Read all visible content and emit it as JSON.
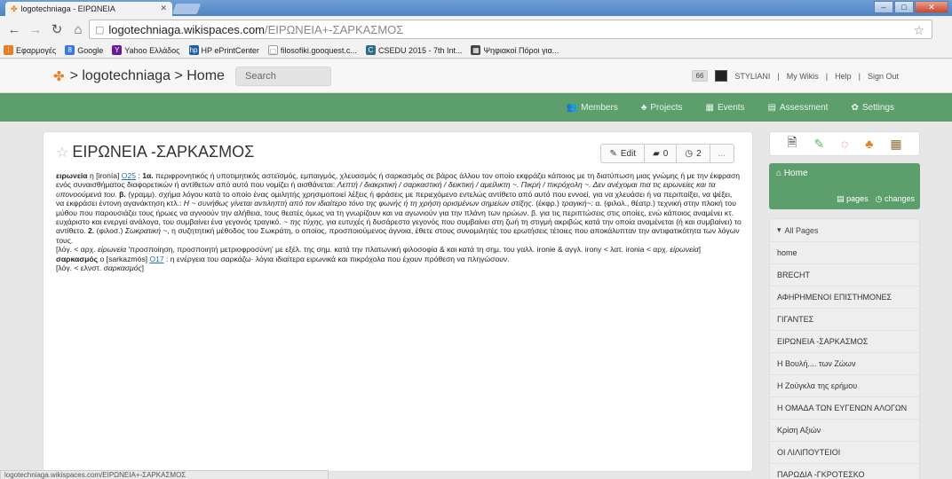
{
  "browser": {
    "tab_title": "logotechniaga - ΕΙΡΩΝΕΙΑ",
    "url_host": "logotechniaga.wikispaces.com",
    "url_path": "/ΕΙΡΩΝΕΙΑ+-ΣΑΡΚΑΣΜΟΣ",
    "bookmarks": [
      "Εφαρμογές",
      "Google",
      "Yahoo Ελλάδος",
      "HP ePrintCenter",
      "filosofiki.gooquest.c...",
      "CSEDU 2015 - 7th Int...",
      "Ψηφιακοί Πόροι για..."
    ],
    "status_text": "logotechniaga.wikispaces.com/ΕΙΡΩΝΕΙΑ+-ΣΑΡΚΑΣΜΟΣ"
  },
  "header": {
    "site": "> logotechniaga > Home",
    "search_placeholder": "Search",
    "badge": "66",
    "user": "STYLIANI",
    "links": [
      "My Wikis",
      "Help",
      "Sign Out"
    ]
  },
  "nav": [
    "Members",
    "Projects",
    "Events",
    "Assessment",
    "Settings"
  ],
  "page": {
    "title": "ΕΙΡΩΝΕΙΑ -ΣΑΡΚΑΣΜΟΣ",
    "edit_label": "Edit",
    "comments_count": "0",
    "revisions_count": "2",
    "more_label": "...",
    "p1_term": "ειρωνεία",
    "p1_ipa": " η [ironía] ",
    "p1_ref": "Ο25",
    "p1_text_a": " : ",
    "p1_sense": "1α.",
    "p1_text_b": " περιφρονητικός ή υποτιμητικός αστεϊσμός, εμπαιγμός, χλευασμός ή σαρκασμός σε βάρος άλλου τον οποίο εκφράζει κάποιος με τη διατύπωση μιας γνώμης ή με την έκφραση ενός συναισθήματος διαφορετικών ή αντίθετων από αυτό που νομίζει ή αισθάνεται: ",
    "p1_ex1": "Λεπτή / διακριτική / σαρκαστική / δεικτική / αμείλικτη ~. Πικρή / πικρόχολη ~. Δεν ανέχομαι πια τις ειρωνείες και τα υπονοούμενά του.",
    "p1_sense_b": " β.",
    "p1_text_c": " (γραμμ). σχήμα λόγου κατά το οποίο ένας ομιλητής χρησιμοποιεί λέξεις ή φράσεις με περιεχόμενο εντελώς αντίθετο από αυτό που εννοεί, για να χλευάσει ή να περιπαίξει, να ψέξει, να εκφράσει έντονη αγανάκτηση κτλ.: ",
    "p1_ex2": "Η ~ συνήθως γίνεται αντιληπτή από τον ιδιαίτερο τόνο της φωνής ή τη χρήση ορισμένων σημείων στίξης.",
    "p1_text_d": " (έκφρ.) ",
    "p1_ex3": "τραγική~:",
    "p1_text_e": " α. (φιλολ., θέατρ.) τεχνική στην πλοκή του μύθου που παρουσιάζει τους ήρωες να αγνοούν την αλήθεια, τους θεατές όμως να τη γνωρίζουν και να αγωνιούν για την πλάνη των ηρώων. β. για τις περιπτώσεις στις οποίες, ενώ κάποιος αναμένει κτ. ευχάριστο και ενεργεί ανάλογα, του συμβαίνει ένα γεγονός τραγικό. ",
    "p1_ex4": "~ της τύχης,",
    "p1_text_f": " για ευτυχές ή δυσάρεστο γεγονός που συμβαίνει στη ζωή τη στιγμή ακριβώς κατά την οποία αναμένεται (ή και συμβαίνει) το αντίθετο. ",
    "p1_sense2": "2.",
    "p1_text_g": " (φιλοσ.) ",
    "p1_ex5": "Σωκρατική",
    "p1_text_h": " ~, η συζητητική μέθοδος του Σωκράτη, ο οποίος, προσποιούμενος άγνοια, έθετε στους συνομιλητές του ερωτήσεις τέτοιες που αποκάλυπταν την αντιφατικότητα των λόγων τους.",
    "p2_a": "[λόγ. < αρχ. ",
    "p2_ex1": "εἰρωνεία",
    "p2_b": " 'προσποίηση, προσποιητή μετριοφροσύνη' με εξέλ. της σημ. κατά την πλατωνική φιλοσοφία & και κατά τη σημ. του γαλλ. ironie & αγγλ. irony < λατ. ironia < αρχ. ",
    "p2_ex2": "εἰρωνεία",
    "p2_c": "]",
    "p3_term": "σαρκασμός",
    "p3_ipa": " ο [sarkazmós] ",
    "p3_ref": "Ο17",
    "p3_text": " : η ενέργεια του σαρκάζω· λόγια ιδιαίτερα ειρωνικά και πικρόχολα που έχουν πρόθεση να πληγώσουν.",
    "p4_a": "[λόγ. < ελνστ. ",
    "p4_ex": "σαρκασμός",
    "p4_b": "]"
  },
  "sidebar": {
    "home_label": "Home",
    "pages_label": "pages",
    "changes_label": "changes",
    "all_pages_label": "All Pages",
    "pages": [
      "home",
      "BRECHT",
      "ΑΦΗΡΗΜΕΝΟΙ ΕΠΙΣΤΗΜΟΝΕΣ",
      "ΓΙΓΑΝΤΕΣ",
      "ΕΙΡΩΝΕΙΑ -ΣΑΡΚΑΣΜΟΣ",
      "Η Βουλή.... των Ζώων",
      "Η Ζούγκλα της ερήμου",
      "Η ΟΜΑΔΑ ΤΩΝ ΕΥΓΕΝΩΝ ΑΛΟΓΩΝ",
      "Κρίση Αξιών",
      "ΟΙ ΛΙΛΙΠΟΥΤΕΙΟΙ",
      "ΠΑΡΩΔΙΑ -ΓΚΡΟΤΕΣΚΟ"
    ]
  }
}
